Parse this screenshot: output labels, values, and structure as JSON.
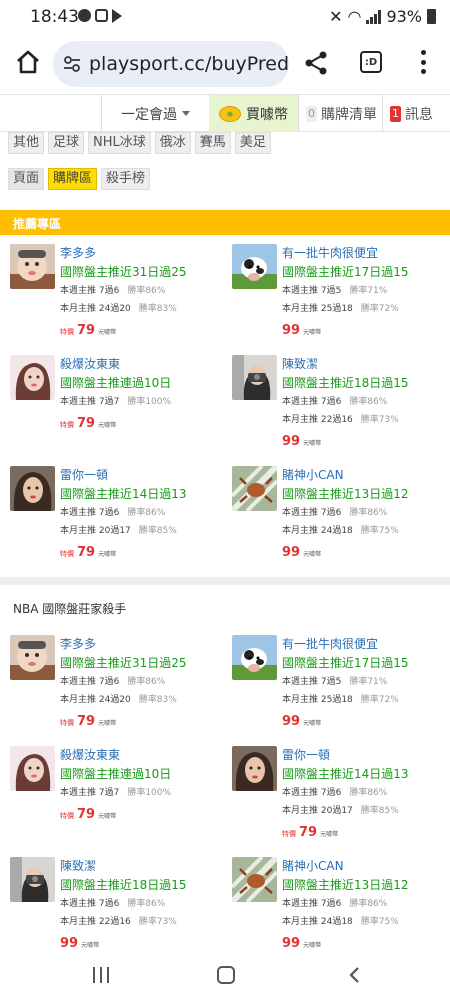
{
  "status": {
    "time": "18:43",
    "battery": "93%"
  },
  "browser": {
    "url": "playsport.cc/buyPredic",
    "tab_label": ":D"
  },
  "topnav": {
    "member_label": "一定會過",
    "buy_label": "買噱幣",
    "cart_label": "購牌清單",
    "cart_count": "0",
    "msg_label": "訊息",
    "msg_count": "1"
  },
  "sport_tags": [
    "其他",
    "足球",
    "NHL冰球",
    "俄冰",
    "賽馬",
    "美足"
  ],
  "page_tags": {
    "label": "頁面",
    "active": "購牌區",
    "other": "殺手榜"
  },
  "recommend_title": "推薦專區",
  "section2_title": "NBA 國際盤莊家殺手",
  "price_special_label": "特價",
  "price_unit": "元噱幣",
  "recommended": [
    {
      "name": "李多多",
      "avatar": "baby",
      "record": "國際盤主推近31日過25",
      "week": "本週主推 7過6",
      "week_rate": "勝率86%",
      "month": "本月主推 24過20",
      "month_rate": "勝率83%",
      "special": true,
      "price": "79"
    },
    {
      "name": "有一批牛肉很便宜",
      "avatar": "cow",
      "record": "國際盤主推近17日過15",
      "week": "本週主推 7過5",
      "week_rate": "勝率71%",
      "month": "本月主推 25過18",
      "month_rate": "勝率72%",
      "special": false,
      "price": "99"
    },
    {
      "name": "殺爆汝東東",
      "avatar": "girl",
      "record": "國際盤主推連過10日",
      "week": "本週主推 7過7",
      "week_rate": "勝率100%",
      "month": "",
      "month_rate": "",
      "special": true,
      "price": "79"
    },
    {
      "name": "陳致潔",
      "avatar": "camera",
      "record": "國際盤主推近18日過15",
      "week": "本週主推 7過6",
      "week_rate": "勝率86%",
      "month": "本月主推 22過16",
      "month_rate": "勝率73%",
      "special": false,
      "price": "99"
    },
    {
      "name": "雷你一頓",
      "avatar": "woman",
      "record": "國際盤主推近14日過13",
      "week": "本週主推 7過6",
      "week_rate": "勝率86%",
      "month": "本月主推 20過17",
      "month_rate": "勝率85%",
      "special": true,
      "price": "79"
    },
    {
      "name": "賭神小CAN",
      "avatar": "crab",
      "record": "國際盤主推近13日過12",
      "week": "本週主推 7過6",
      "week_rate": "勝率86%",
      "month": "本月主推 24過18",
      "month_rate": "勝率75%",
      "special": false,
      "price": "99"
    }
  ],
  "nba_killers": [
    {
      "name": "李多多",
      "avatar": "baby",
      "record": "國際盤主推近31日過25",
      "week": "本週主推 7過6",
      "week_rate": "勝率86%",
      "month": "本月主推 24過20",
      "month_rate": "勝率83%",
      "special": true,
      "price": "79"
    },
    {
      "name": "有一批牛肉很便宜",
      "avatar": "cow",
      "record": "國際盤主推近17日過15",
      "week": "本週主推 7過5",
      "week_rate": "勝率71%",
      "month": "本月主推 25過18",
      "month_rate": "勝率72%",
      "special": false,
      "price": "99"
    },
    {
      "name": "殺爆汝東東",
      "avatar": "girl",
      "record": "國際盤主推連過10日",
      "week": "本週主推 7過7",
      "week_rate": "勝率100%",
      "month": "",
      "month_rate": "",
      "special": true,
      "price": "79"
    },
    {
      "name": "雷你一頓",
      "avatar": "woman",
      "record": "國際盤主推近14日過13",
      "week": "本週主推 7過6",
      "week_rate": "勝率86%",
      "month": "本月主推 20過17",
      "month_rate": "勝率85%",
      "special": true,
      "price": "79"
    },
    {
      "name": "陳致潔",
      "avatar": "camera",
      "record": "國際盤主推近18日過15",
      "week": "本週主推 7過6",
      "week_rate": "勝率86%",
      "month": "本月主推 22過16",
      "month_rate": "勝率73%",
      "special": false,
      "price": "99"
    },
    {
      "name": "賭神小CAN",
      "avatar": "crab",
      "record": "國際盤主推近13日過12",
      "week": "本週主推 7過6",
      "week_rate": "勝率86%",
      "month": "本月主推 24過18",
      "month_rate": "勝率75%",
      "special": false,
      "price": "99"
    }
  ]
}
